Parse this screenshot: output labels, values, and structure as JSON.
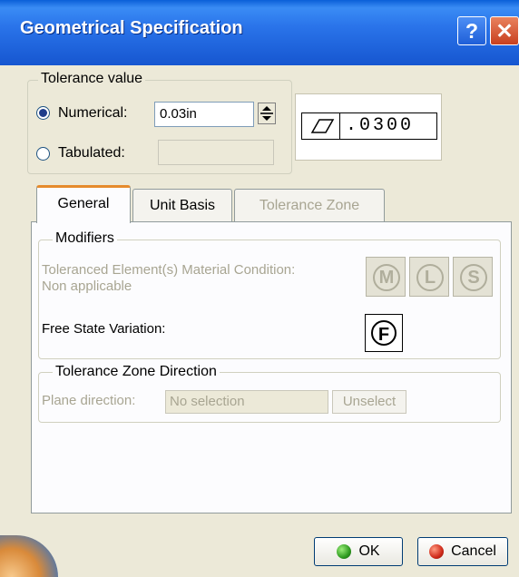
{
  "window": {
    "title": "Geometrical Specification",
    "help_glyph": "?",
    "close_glyph": "✕"
  },
  "tolerance": {
    "group_label": "Tolerance value",
    "numerical_label": "Numerical:",
    "numerical_value": "0.03in",
    "numerical_selected": true,
    "tabulated_label": "Tabulated:",
    "tabulated_value": "",
    "preview_value": ".0300",
    "preview_symbol": "flatness-icon"
  },
  "tabs": [
    {
      "label": "General",
      "active": true,
      "enabled": true
    },
    {
      "label": "Unit Basis",
      "active": false,
      "enabled": true
    },
    {
      "label": "Tolerance Zone",
      "active": false,
      "enabled": false
    }
  ],
  "modifiers": {
    "group_label": "Modifiers",
    "material_condition_label": "Toleranced Element(s) Material Condition:",
    "material_condition_value": "Non applicable",
    "mmc_glyph": "M",
    "lmc_glyph": "L",
    "rfs_glyph": "S",
    "free_state_label": "Free State Variation:",
    "free_state_glyph": "F"
  },
  "zone_direction": {
    "group_label": "Tolerance Zone Direction",
    "plane_label": "Plane direction:",
    "plane_value": "No selection",
    "unselect_label": "Unselect"
  },
  "footer": {
    "ok_label": "OK",
    "cancel_label": "Cancel"
  },
  "colors": {
    "title_bar": "#1656d0",
    "dialog_bg": "#ece9d8",
    "ok_icon": "#2e9a1f",
    "cancel_icon": "#cf2a1a"
  }
}
